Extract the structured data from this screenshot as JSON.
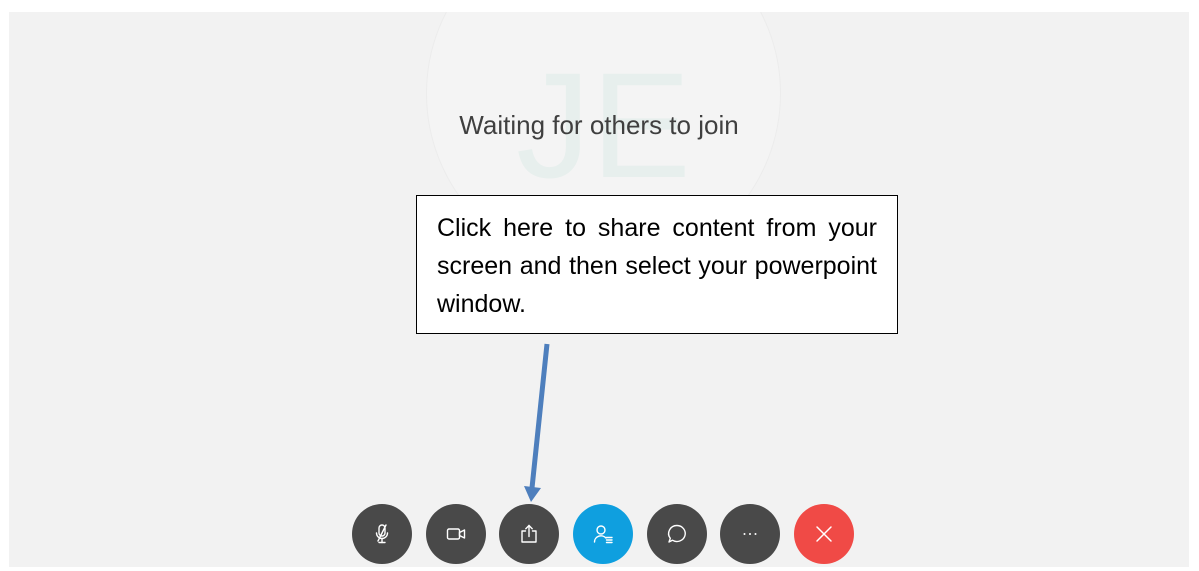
{
  "meeting": {
    "avatar_initials": "JE",
    "status_text": "Waiting for others to join"
  },
  "callout": {
    "text": "Click here to share content from your screen and then select your powerpoint window."
  },
  "toolbar": {
    "buttons": [
      {
        "name": "mute",
        "icon": "microphone-muted-icon"
      },
      {
        "name": "video",
        "icon": "video-camera-icon"
      },
      {
        "name": "share",
        "icon": "share-upload-icon"
      },
      {
        "name": "participants",
        "icon": "participants-icon"
      },
      {
        "name": "chat",
        "icon": "chat-bubble-icon"
      },
      {
        "name": "more",
        "icon": "ellipsis-icon"
      },
      {
        "name": "leave",
        "icon": "close-icon"
      }
    ],
    "colors": {
      "default": "#494949",
      "participants": "#0f9fdf",
      "leave": "#f04a46"
    }
  },
  "annotation_arrow_color": "#4e7fbd"
}
